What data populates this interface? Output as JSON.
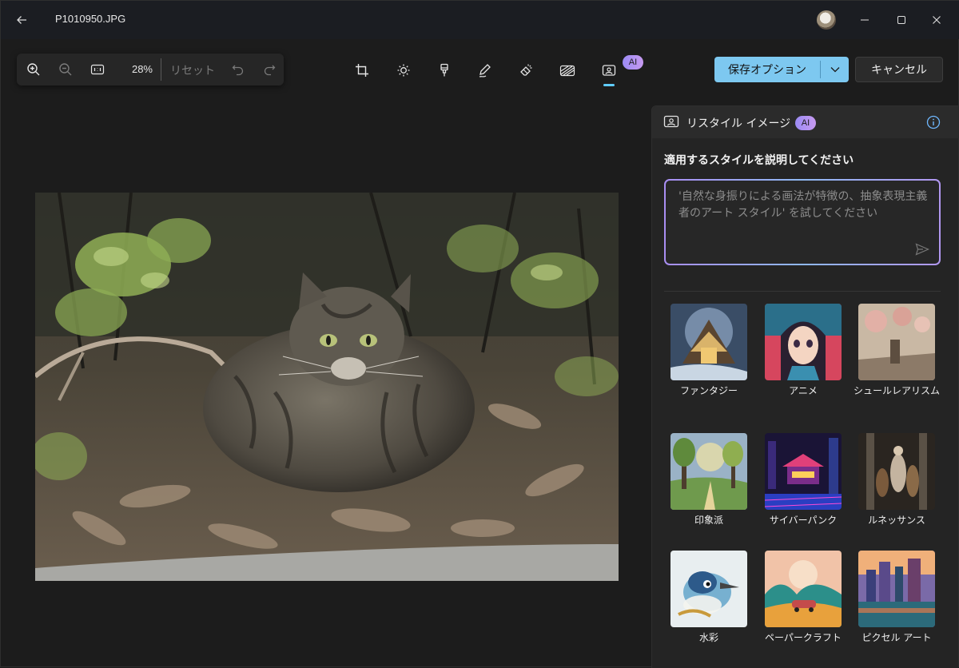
{
  "titlebar": {
    "file_name": "P1010950.JPG"
  },
  "toolbar": {
    "zoom_level": "28%",
    "reset_label": "リセット",
    "ai_badge": "AI",
    "save_label": "保存オプション",
    "cancel_label": "キャンセル",
    "tools": [
      "crop-icon",
      "brightness-icon",
      "retouch-brush-icon",
      "markup-pen-icon",
      "erase-icon",
      "background-icon",
      "restyle-image-icon"
    ],
    "accent_color": "#60cdff",
    "save_button_color": "#7dc8f0"
  },
  "panel": {
    "title": "リスタイル イメージ",
    "ai_badge": "AI",
    "prompt_label": "適用するスタイルを説明してください",
    "prompt_placeholder": "'自然な身振りによる画法が特徴の、抽象表現主義者のアート スタイル' を試してください",
    "styles": [
      {
        "label": "ファンタジー"
      },
      {
        "label": "アニメ"
      },
      {
        "label": "シュールレアリスム"
      },
      {
        "label": "印象派"
      },
      {
        "label": "サイバーパンク"
      },
      {
        "label": "ルネッサンス"
      },
      {
        "label": "水彩"
      },
      {
        "label": "ペーパークラフト"
      },
      {
        "label": "ピクセル アート"
      }
    ]
  }
}
